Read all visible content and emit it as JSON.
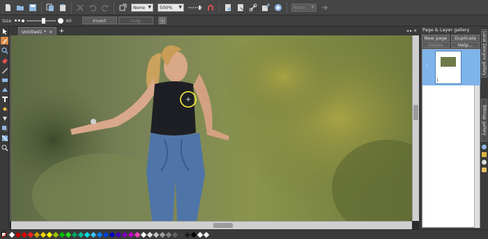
{
  "toolbar": {
    "fill_select": "None",
    "zoom_value": "500%",
    "disabled_select": "None"
  },
  "infobar": {
    "size_label": "Size",
    "brush_size": "40",
    "invert_label": "Invert",
    "crop_label": "Crop"
  },
  "document": {
    "tab_title": "Untitled1 *",
    "tab_close": "×",
    "new_tab": "+"
  },
  "panel": {
    "title": "Page & Layer gallery",
    "new_page": "New page",
    "duplicate": "Duplicate",
    "delete": "Delete",
    "help": "Help...",
    "page_number": "1"
  },
  "side_tabs": {
    "local_designs": "Local Designs gallery",
    "bitmap": "Bitmap gallery"
  },
  "colors": {
    "accent": "#7fb4ea",
    "selection_circle": "#e8e337"
  },
  "palette_colors": [
    "#ffffff",
    "#c00000",
    "#e00000",
    "#ff2020",
    "#d0a000",
    "#f0d000",
    "#ffff00",
    "#a0c000",
    "#00c000",
    "#20e020",
    "#00a060",
    "#00c0a0",
    "#00e0e0",
    "#40c0ff",
    "#0080ff",
    "#0040e0",
    "#0000c0",
    "#4000c0",
    "#8000c0",
    "#c000c0",
    "#ff40c0",
    "#ffffff",
    "#e0e0e0",
    "#c0c0c0",
    "#a0a0a0",
    "#808080",
    "#606060",
    "#404040",
    "#202020",
    "#000000",
    "#ffffff",
    "#f0f0f0"
  ]
}
